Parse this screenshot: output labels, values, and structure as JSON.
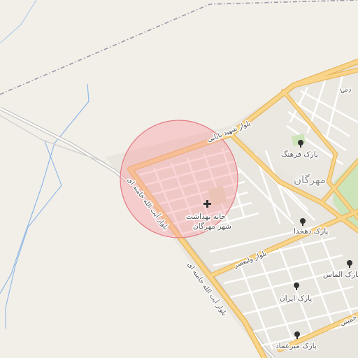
{
  "map": {
    "labels": {
      "district": "مهرگان",
      "health_center_line1": "خانه بهداشت",
      "health_center_line2": "شهر مهرگان",
      "road_shahid_babaei": "بلوار شهید بابایی",
      "road_khamenei_upper": "بلوار آیت الله خامنه ای",
      "road_khamenei_lower": "بلوار آیت الله خامنه ای",
      "road_valiasr": "بلوار ولیعصر",
      "road_reza": "رضا",
      "road_khomeini": "خمینی",
      "park_farhang": "پارک فرهنگ",
      "park_dehkhoda": "پارک دهخدا",
      "park_almas": "پارک الماس",
      "park_iran": "پارک ایران",
      "park_miremad": "پارک میرعماد"
    },
    "icons": {
      "health_center": "medical-cross-icon",
      "park": "tree-icon"
    },
    "colors": {
      "land": "#f2efe9",
      "urban": "#e9e5df",
      "minor_road": "#ffffff",
      "major_road": "#f8d58a",
      "major_road_casing": "#e8b55a",
      "waterway": "#8fb8e8",
      "boundary": "#9a98a8",
      "park": "#cde3b9",
      "highlight_fill": "#f6a3a8",
      "highlight_stroke": "#e57b84"
    }
  }
}
